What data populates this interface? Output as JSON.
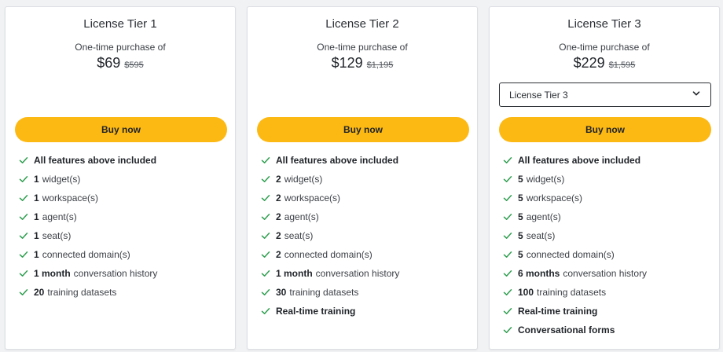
{
  "colors": {
    "accent": "#fdb913",
    "check": "#2e9e4f",
    "page_bg": "#f1f2f4"
  },
  "icons": {
    "feature": "check-icon",
    "dropdown": "chevron-down-icon"
  },
  "tiers": [
    {
      "title": "License Tier 1",
      "subtitle": "One-time purchase of",
      "price": "$69",
      "old_price": "$595",
      "buy_label": "Buy now",
      "features": [
        {
          "bold": "All features above included",
          "rest": ""
        },
        {
          "bold": "1",
          "rest": "widget(s)"
        },
        {
          "bold": "1",
          "rest": "workspace(s)"
        },
        {
          "bold": "1",
          "rest": "agent(s)"
        },
        {
          "bold": "1",
          "rest": "seat(s)"
        },
        {
          "bold": "1",
          "rest": "connected domain(s)"
        },
        {
          "bold": "1 month",
          "rest": "conversation history"
        },
        {
          "bold": "20",
          "rest": "training datasets"
        }
      ]
    },
    {
      "title": "License Tier 2",
      "subtitle": "One-time purchase of",
      "price": "$129",
      "old_price": "$1,195",
      "buy_label": "Buy now",
      "features": [
        {
          "bold": "All features above included",
          "rest": ""
        },
        {
          "bold": "2",
          "rest": "widget(s)"
        },
        {
          "bold": "2",
          "rest": "workspace(s)"
        },
        {
          "bold": "2",
          "rest": "agent(s)"
        },
        {
          "bold": "2",
          "rest": "seat(s)"
        },
        {
          "bold": "2",
          "rest": "connected domain(s)"
        },
        {
          "bold": "1 month",
          "rest": "conversation history"
        },
        {
          "bold": "30",
          "rest": "training datasets"
        },
        {
          "bold": "Real-time training",
          "rest": ""
        }
      ]
    },
    {
      "title": "License Tier 3",
      "subtitle": "One-time purchase of",
      "price": "$229",
      "old_price": "$1,595",
      "select_value": "License Tier 3",
      "buy_label": "Buy now",
      "features": [
        {
          "bold": "All features above included",
          "rest": ""
        },
        {
          "bold": "5",
          "rest": "widget(s)"
        },
        {
          "bold": "5",
          "rest": "workspace(s)"
        },
        {
          "bold": "5",
          "rest": "agent(s)"
        },
        {
          "bold": "5",
          "rest": "seat(s)"
        },
        {
          "bold": "5",
          "rest": "connected domain(s)"
        },
        {
          "bold": "6 months",
          "rest": "conversation history"
        },
        {
          "bold": "100",
          "rest": "training datasets"
        },
        {
          "bold": "Real-time training",
          "rest": ""
        },
        {
          "bold": "Conversational forms",
          "rest": ""
        }
      ]
    }
  ]
}
